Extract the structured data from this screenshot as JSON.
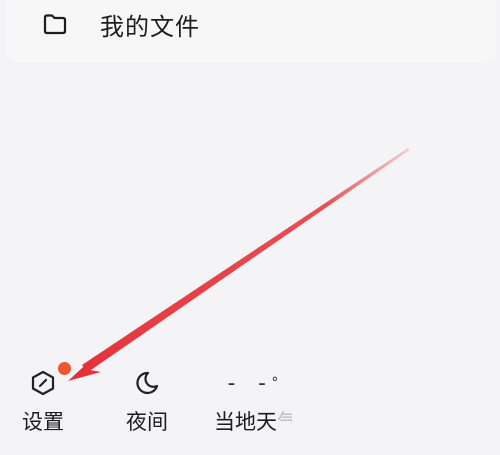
{
  "menu": {
    "my_files_label": "我的文件",
    "my_files_icon": "folder-icon"
  },
  "bottom_bar": {
    "settings": {
      "label": "设置",
      "icon": "hexagon-settings-icon",
      "has_badge": true,
      "badge_color": "#f25533"
    },
    "night": {
      "label": "夜间",
      "icon": "moon-icon"
    },
    "weather": {
      "label": "当地天",
      "label_faded": "气",
      "value": "- -",
      "deg": "°"
    }
  },
  "colors": {
    "background": "#f4f4f6",
    "card": "#f7f7f8",
    "arrow": "#e5323a",
    "badge": "#f25533"
  }
}
